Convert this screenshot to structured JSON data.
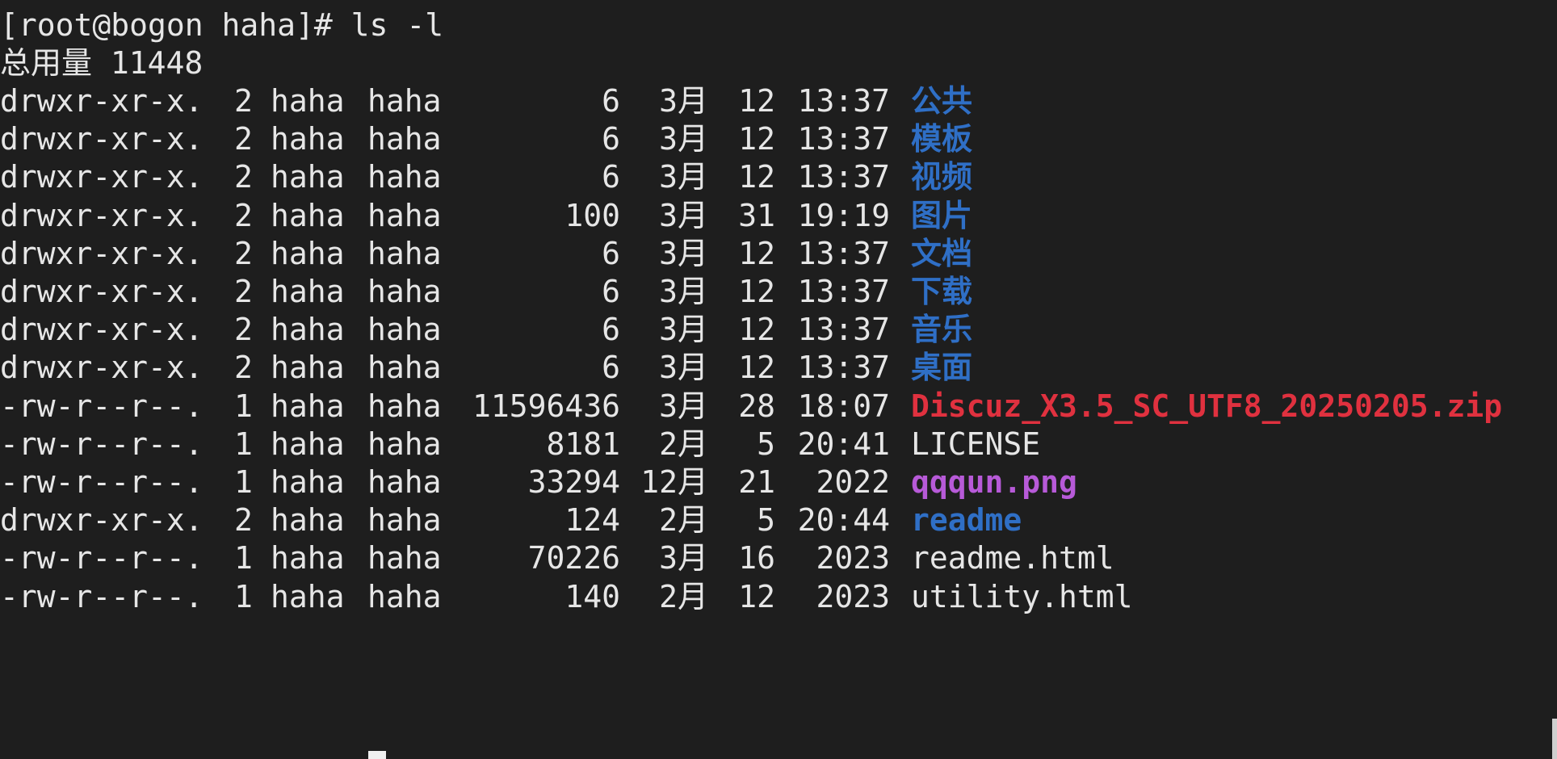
{
  "prompt_line": "[root@bogon haha]# ls -l",
  "total_line": "总用量 11448",
  "entries": [
    {
      "perm": "drwxr-xr-x.",
      "links": "2",
      "owner": "haha",
      "group": "haha",
      "size": "6",
      "month": "3月",
      "day": "12",
      "time": "13:37",
      "name": "公共",
      "kind": "dir"
    },
    {
      "perm": "drwxr-xr-x.",
      "links": "2",
      "owner": "haha",
      "group": "haha",
      "size": "6",
      "month": "3月",
      "day": "12",
      "time": "13:37",
      "name": "模板",
      "kind": "dir"
    },
    {
      "perm": "drwxr-xr-x.",
      "links": "2",
      "owner": "haha",
      "group": "haha",
      "size": "6",
      "month": "3月",
      "day": "12",
      "time": "13:37",
      "name": "视频",
      "kind": "dir"
    },
    {
      "perm": "drwxr-xr-x.",
      "links": "2",
      "owner": "haha",
      "group": "haha",
      "size": "100",
      "month": "3月",
      "day": "31",
      "time": "19:19",
      "name": "图片",
      "kind": "dir"
    },
    {
      "perm": "drwxr-xr-x.",
      "links": "2",
      "owner": "haha",
      "group": "haha",
      "size": "6",
      "month": "3月",
      "day": "12",
      "time": "13:37",
      "name": "文档",
      "kind": "dir"
    },
    {
      "perm": "drwxr-xr-x.",
      "links": "2",
      "owner": "haha",
      "group": "haha",
      "size": "6",
      "month": "3月",
      "day": "12",
      "time": "13:37",
      "name": "下载",
      "kind": "dir"
    },
    {
      "perm": "drwxr-xr-x.",
      "links": "2",
      "owner": "haha",
      "group": "haha",
      "size": "6",
      "month": "3月",
      "day": "12",
      "time": "13:37",
      "name": "音乐",
      "kind": "dir"
    },
    {
      "perm": "drwxr-xr-x.",
      "links": "2",
      "owner": "haha",
      "group": "haha",
      "size": "6",
      "month": "3月",
      "day": "12",
      "time": "13:37",
      "name": "桌面",
      "kind": "dir"
    },
    {
      "perm": "-rw-r--r--.",
      "links": "1",
      "owner": "haha",
      "group": "haha",
      "size": "11596436",
      "month": "3月",
      "day": "28",
      "time": "18:07",
      "name": "Discuz_X3.5_SC_UTF8_20250205.zip",
      "kind": "archive"
    },
    {
      "perm": "-rw-r--r--.",
      "links": "1",
      "owner": "haha",
      "group": "haha",
      "size": "8181",
      "month": "2月",
      "day": "5",
      "time": "20:41",
      "name": "LICENSE",
      "kind": "file"
    },
    {
      "perm": "-rw-r--r--.",
      "links": "1",
      "owner": "haha",
      "group": "haha",
      "size": "33294",
      "month": "12月",
      "day": "21",
      "time": "2022",
      "name": "qqqun.png",
      "kind": "image"
    },
    {
      "perm": "drwxr-xr-x.",
      "links": "2",
      "owner": "haha",
      "group": "haha",
      "size": "124",
      "month": "2月",
      "day": "5",
      "time": "20:44",
      "name": "readme",
      "kind": "dir"
    },
    {
      "perm": "-rw-r--r--.",
      "links": "1",
      "owner": "haha",
      "group": "haha",
      "size": "70226",
      "month": "3月",
      "day": "16",
      "time": "2023",
      "name": "readme.html",
      "kind": "file"
    },
    {
      "perm": "-rw-r--r--.",
      "links": "1",
      "owner": "haha",
      "group": "haha",
      "size": "140",
      "month": "2月",
      "day": "12",
      "time": "2023",
      "name": "utility.html",
      "kind": "file"
    }
  ],
  "colors": {
    "background": "#1e1e1e",
    "text": "#e6e6e6",
    "directory": "#2f6fc6",
    "archive": "#e0313f",
    "image": "#b75ad8"
  }
}
